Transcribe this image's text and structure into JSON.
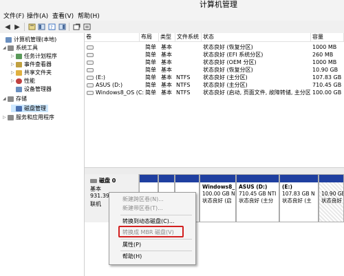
{
  "window": {
    "title": "计算机管理"
  },
  "menu": [
    "文件(F)",
    "操作(A)",
    "查看(V)",
    "帮助(H)"
  ],
  "toolbar": {
    "icons": [
      "back-icon",
      "forward-icon",
      "up-icon",
      "properties-icon",
      "help-icon",
      "list-icon",
      "export-icon",
      "settings-icon"
    ]
  },
  "tree": {
    "items": [
      {
        "label": "计算机管理(本地)",
        "exp": "",
        "icon": "computer-icon",
        "color": "#6a8fbf"
      },
      {
        "label": "系统工具",
        "exp": "◢",
        "icon": "tools-icon",
        "color": "#8a8a8a"
      },
      {
        "label": "任务计划程序",
        "exp": "▷",
        "icon": "clock-icon",
        "color": "#5a9a5a"
      },
      {
        "label": "事件查看器",
        "exp": "▷",
        "icon": "event-icon",
        "color": "#c0a040"
      },
      {
        "label": "共享文件夹",
        "exp": "▷",
        "icon": "folder-icon",
        "color": "#e0b040"
      },
      {
        "label": "性能",
        "exp": "▷",
        "icon": "performance-icon",
        "color": "#c04040"
      },
      {
        "label": "设备管理器",
        "exp": "",
        "icon": "device-icon",
        "color": "#6a8fbf"
      },
      {
        "label": "存储",
        "exp": "◢",
        "icon": "storage-icon",
        "color": "#8a8a8a"
      },
      {
        "label": "磁盘管理",
        "exp": "",
        "icon": "disk-icon",
        "color": "#4a70b0"
      },
      {
        "label": "服务和应用程序",
        "exp": "▷",
        "icon": "services-icon",
        "color": "#8a8a8a"
      }
    ]
  },
  "volumes": {
    "headers": [
      "卷",
      "布局",
      "类型",
      "文件系统",
      "状态",
      "容量"
    ],
    "rows": [
      {
        "vol": "",
        "layout": "简单",
        "type": "基本",
        "fs": "",
        "status": "状态良好 (恢复分区)",
        "cap": "1000 MB"
      },
      {
        "vol": "",
        "layout": "简单",
        "type": "基本",
        "fs": "",
        "status": "状态良好 (EFI 系统分区)",
        "cap": "260 MB"
      },
      {
        "vol": "",
        "layout": "简单",
        "type": "基本",
        "fs": "",
        "status": "状态良好 (OEM 分区)",
        "cap": "1000 MB"
      },
      {
        "vol": "",
        "layout": "简单",
        "type": "基本",
        "fs": "",
        "status": "状态良好 (恢复分区)",
        "cap": "10.90 GB"
      },
      {
        "vol": "(E:)",
        "layout": "简单",
        "type": "基本",
        "fs": "NTFS",
        "status": "状态良好 (主分区)",
        "cap": "107.83 GB"
      },
      {
        "vol": "ASUS (D:)",
        "layout": "简单",
        "type": "基本",
        "fs": "NTFS",
        "status": "状态良好 (主分区)",
        "cap": "710.45 GB"
      },
      {
        "vol": "Windows8_OS (C:)",
        "layout": "简单",
        "type": "基本",
        "fs": "NTFS",
        "status": "状态良好 (启动, 页面文件, 故障转储, 主分区)",
        "cap": "100.00 GB"
      }
    ]
  },
  "disk": {
    "name": "磁盘 0",
    "type": "基本",
    "size": "931.39",
    "state": "联机",
    "partitions": [
      {
        "name": "",
        "size": "",
        "status": ""
      },
      {
        "name": "",
        "size": "",
        "status": ""
      },
      {
        "name": "",
        "size": "",
        "status": ""
      },
      {
        "name": "Windows8_",
        "size": "100.00 GB N",
        "status": "状态良好 (启"
      },
      {
        "name": "ASUS  (D:)",
        "size": "710.45 GB NTI",
        "status": "状态良好 (主分"
      },
      {
        "name": "(E:)",
        "size": "107.83 GB N",
        "status": "状态良好 (主"
      },
      {
        "name": "",
        "size": "10.90 GB",
        "status": "状态良好"
      }
    ]
  },
  "context_menu": {
    "items": [
      {
        "label": "新建跨区卷(N)...",
        "disabled": true
      },
      {
        "label": "新建带区卷(T)...",
        "disabled": true
      },
      {
        "label": "转换到动态磁盘(C)...",
        "disabled": false
      },
      {
        "label": "转换成 MBR 磁盘(V)",
        "disabled": true
      },
      {
        "label": "属性(P)",
        "disabled": false
      },
      {
        "label": "帮助(H)",
        "disabled": false
      }
    ]
  },
  "colors": {
    "partition_bar": "#1f3fa0",
    "highlight": "#d21e1e",
    "selection": "#cde8ff"
  }
}
